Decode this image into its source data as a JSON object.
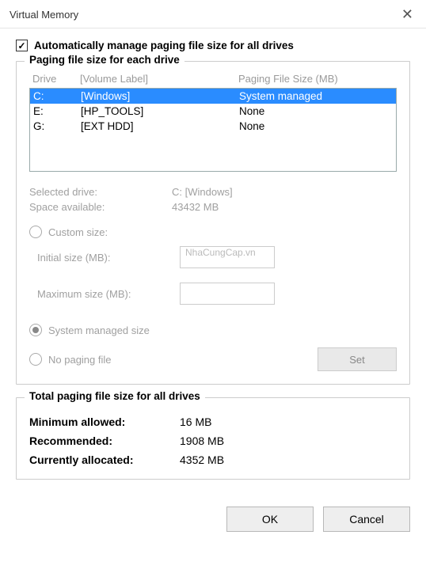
{
  "window": {
    "title": "Virtual Memory",
    "close": "✕"
  },
  "auto_manage": {
    "checked": "✓",
    "label": "Automatically manage paging file size for all drives"
  },
  "group1": {
    "legend": "Paging file size for each drive",
    "header_drive": "Drive",
    "header_label": "[Volume Label]",
    "header_size": "Paging File Size (MB)",
    "rows": [
      {
        "drive": "C:",
        "label": "[Windows]",
        "size": "System managed",
        "selected": true
      },
      {
        "drive": "E:",
        "label": "[HP_TOOLS]",
        "size": "None",
        "selected": false
      },
      {
        "drive": "G:",
        "label": "[EXT HDD]",
        "size": "None",
        "selected": false
      }
    ],
    "selected_drive_label": "Selected drive:",
    "selected_drive_value": "C:  [Windows]",
    "space_label": "Space available:",
    "space_value": "43432 MB",
    "custom_size": "Custom size:",
    "initial_size": "Initial size (MB):",
    "max_size": "Maximum size (MB):",
    "watermark": "NhaCungCap.vn",
    "system_managed": "System managed size",
    "no_paging": "No paging file",
    "set_btn": "Set"
  },
  "group2": {
    "legend": "Total paging file size for all drives",
    "min_label": "Minimum allowed:",
    "min_value": "16 MB",
    "rec_label": "Recommended:",
    "rec_value": "1908 MB",
    "cur_label": "Currently allocated:",
    "cur_value": "4352 MB"
  },
  "buttons": {
    "ok": "OK",
    "cancel": "Cancel"
  }
}
